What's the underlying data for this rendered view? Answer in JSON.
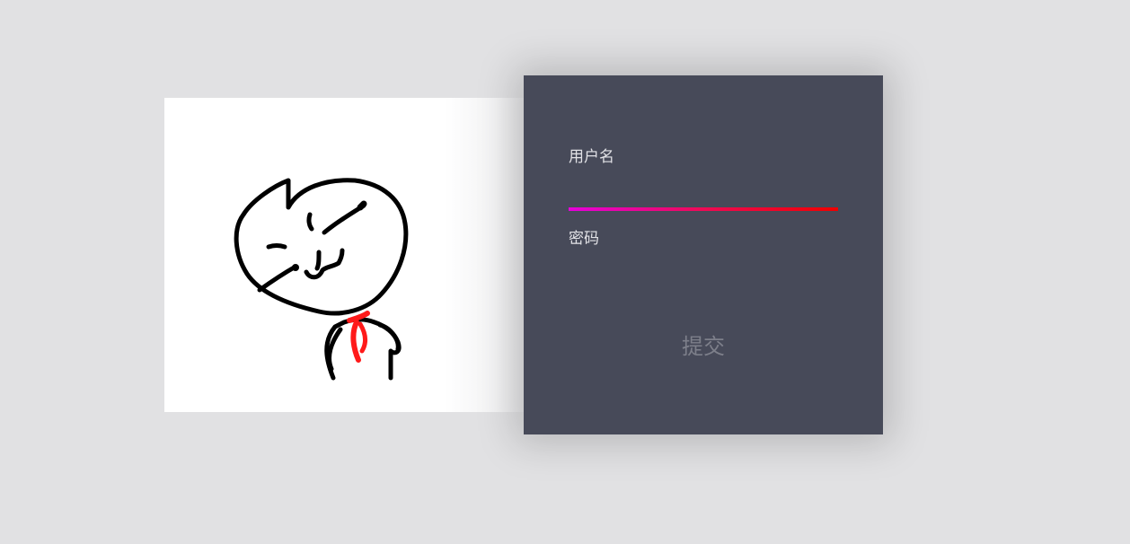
{
  "form": {
    "username_label": "用户名",
    "username_value": "",
    "password_label": "密码",
    "password_value": "",
    "submit_label": "提交"
  },
  "colors": {
    "page_background": "#e1e1e3",
    "panel_background": "#474a59",
    "underline_gradient_start": "#e600dc",
    "underline_gradient_end": "#f00000",
    "ribbon": "#ff1a1a"
  },
  "illustration": {
    "icon": "meme-face-illustration"
  }
}
